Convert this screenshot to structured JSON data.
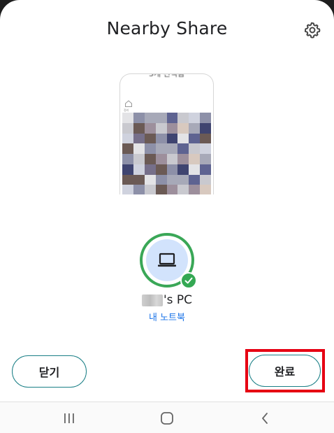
{
  "sheet": {
    "title": "Nearby Share"
  },
  "preview": {
    "header_text": "3개 선택됨",
    "home_label": "정리"
  },
  "device": {
    "name_suffix": "'s PC",
    "subtitle": "내 노트북",
    "icon": "laptop-icon",
    "status": "sent-checkmark"
  },
  "actions": {
    "close_label": "닫기",
    "done_label": "완료"
  },
  "colors": {
    "accent_green": "#34a853",
    "accent_blue": "#1a73e8",
    "button_border": "#1a7f86",
    "highlight_red": "#e60012"
  },
  "navbar": {
    "recent_icon": "recent-apps-icon",
    "home_icon": "home-icon",
    "back_icon": "back-icon"
  }
}
